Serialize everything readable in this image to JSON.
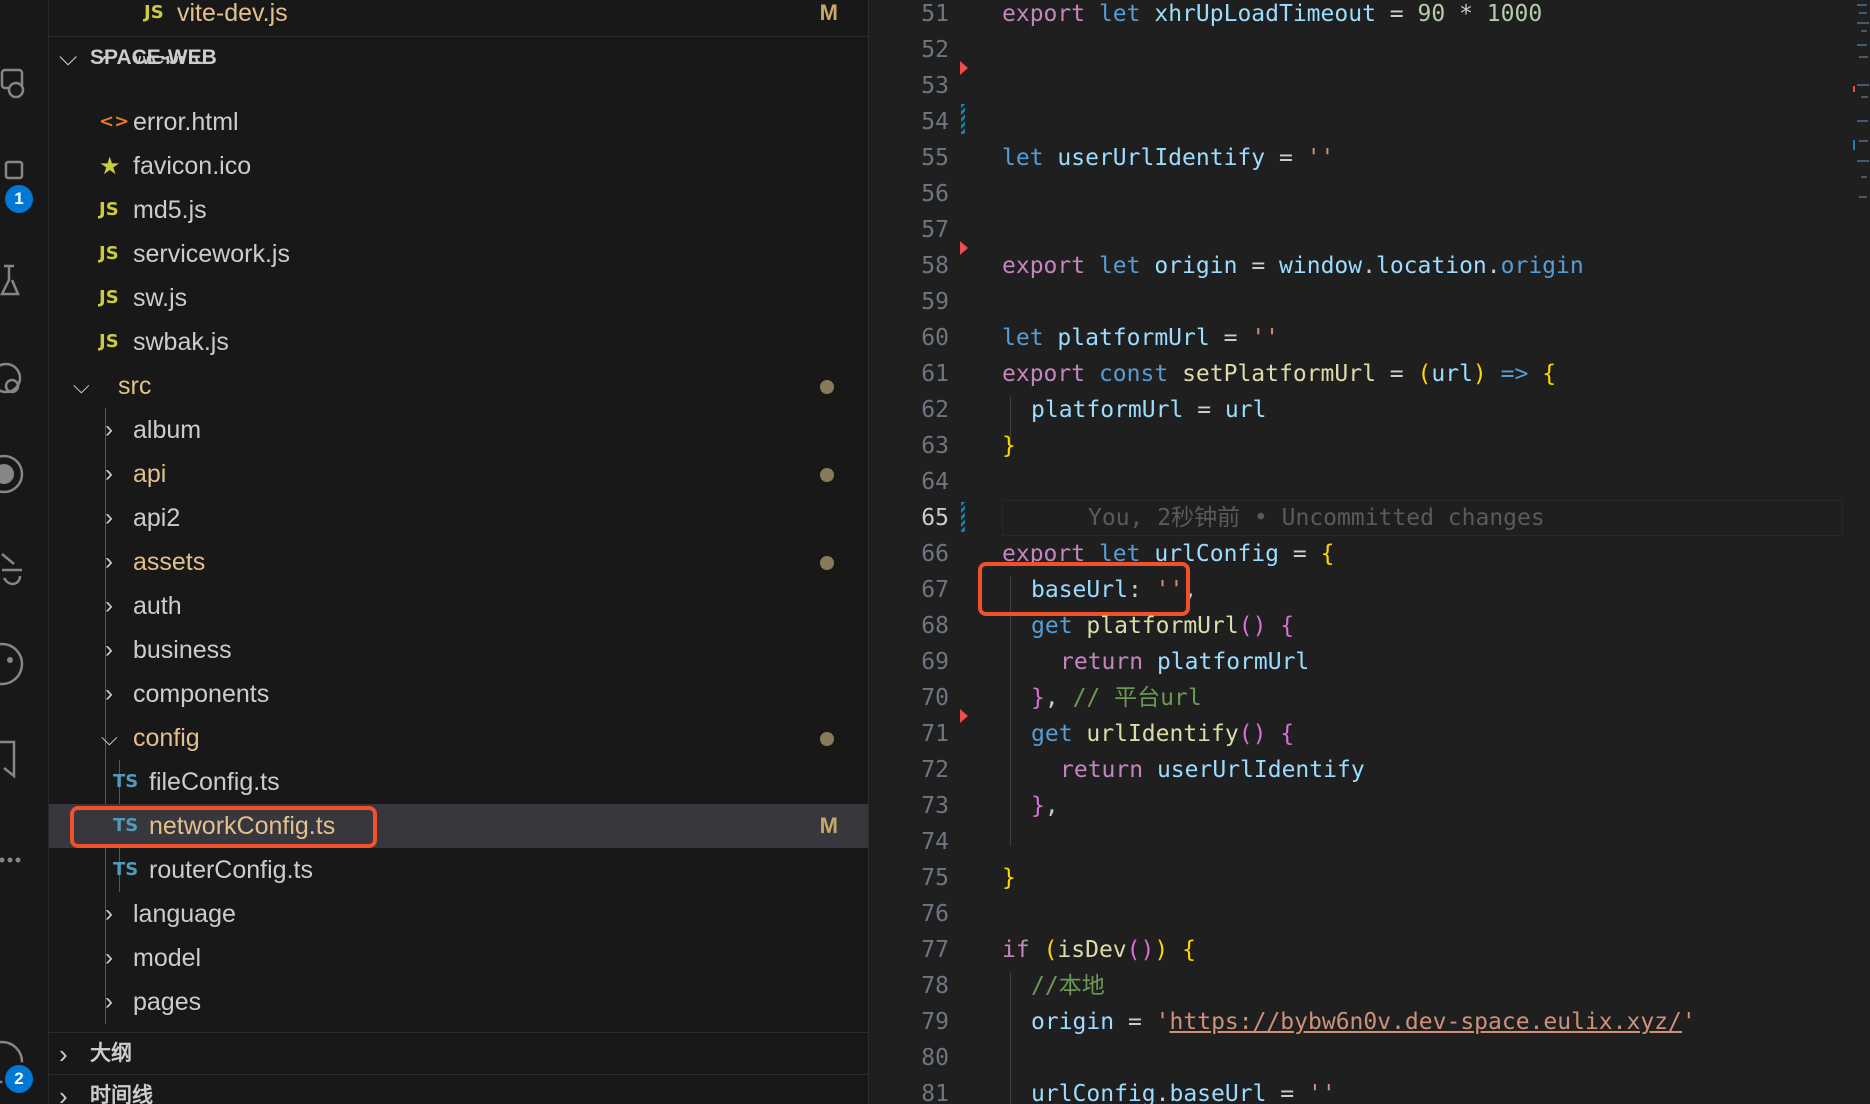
{
  "activity_bar": {
    "badges": [
      "1",
      "2"
    ]
  },
  "explorer": {
    "top_file": {
      "name": "vite-dev.js",
      "icon": "JS",
      "status": "M"
    },
    "workspace_title": "SPACE-WEB",
    "partial_item": "webrtc",
    "files_root": [
      {
        "name": "error.html",
        "icon": "<>"
      },
      {
        "name": "favicon.ico",
        "icon": "★"
      },
      {
        "name": "md5.js",
        "icon": "JS"
      },
      {
        "name": "servicework.js",
        "icon": "JS"
      },
      {
        "name": "sw.js",
        "icon": "JS"
      },
      {
        "name": "swbak.js",
        "icon": "JS"
      }
    ],
    "src_folder": "src",
    "src_children": [
      {
        "name": "album"
      },
      {
        "name": "api"
      },
      {
        "name": "api2"
      },
      {
        "name": "assets"
      },
      {
        "name": "auth"
      },
      {
        "name": "business"
      },
      {
        "name": "components"
      },
      {
        "name": "config"
      }
    ],
    "config_children": [
      {
        "name": "fileConfig.ts",
        "icon": "TS"
      },
      {
        "name": "networkConfig.ts",
        "icon": "TS",
        "status": "M"
      },
      {
        "name": "routerConfig.ts",
        "icon": "TS"
      }
    ],
    "after_config": [
      {
        "name": "language"
      },
      {
        "name": "model"
      },
      {
        "name": "pages"
      }
    ],
    "outline_title": "大纲",
    "timeline_title": "时间线"
  },
  "editor": {
    "line_numbers": [
      "51",
      "52",
      "53",
      "54",
      "55",
      "56",
      "57",
      "58",
      "59",
      "60",
      "61",
      "62",
      "63",
      "64",
      "65",
      "66",
      "67",
      "68",
      "69",
      "70",
      "71",
      "72",
      "73",
      "74",
      "75",
      "76",
      "77",
      "78",
      "79",
      "80",
      "81"
    ],
    "active_line": "65",
    "blame": "You, 2秒钟前 • Uncommitted changes",
    "lines": {
      "l51": [
        "export",
        "let",
        "xhrUpLoadTimeout",
        "=",
        "90",
        "*",
        "1000"
      ],
      "l55": [
        "let",
        "userUrlIdentify",
        "=",
        "''"
      ],
      "l58": [
        "export",
        "let",
        "origin",
        "=",
        "window",
        "location",
        "origin"
      ],
      "l60": [
        "let",
        "platformUrl",
        "=",
        "''"
      ],
      "l61": [
        "export",
        "const",
        "setPlatformUrl",
        "=",
        "(",
        "url",
        ")",
        "=>",
        "{"
      ],
      "l62": [
        "platformUrl",
        "=",
        "url"
      ],
      "l63": [
        "}"
      ],
      "l66": [
        "export",
        "let",
        "urlConfig",
        "=",
        "{"
      ],
      "l67": [
        "baseUrl",
        ":",
        "''",
        ","
      ],
      "l68": [
        "get",
        "platformUrl",
        "()",
        "{"
      ],
      "l69": [
        "return",
        "platformUrl"
      ],
      "l70": [
        "}",
        ",",
        "// 平台url"
      ],
      "l71": [
        "get",
        "urlIdentify",
        "()",
        "{"
      ],
      "l72": [
        "return",
        "userUrlIdentify"
      ],
      "l73": [
        "}",
        ","
      ],
      "l75": [
        "}"
      ],
      "l77": [
        "if",
        "(",
        "isDev",
        "()",
        ")",
        "{"
      ],
      "l78": [
        "//本地"
      ],
      "l79": [
        "origin",
        "=",
        "'",
        "https://bybw6n0v.dev-space.eulix.xyz/",
        "'"
      ],
      "l81": [
        "urlConfig",
        ".",
        "baseUrl",
        "=",
        "''"
      ]
    }
  }
}
